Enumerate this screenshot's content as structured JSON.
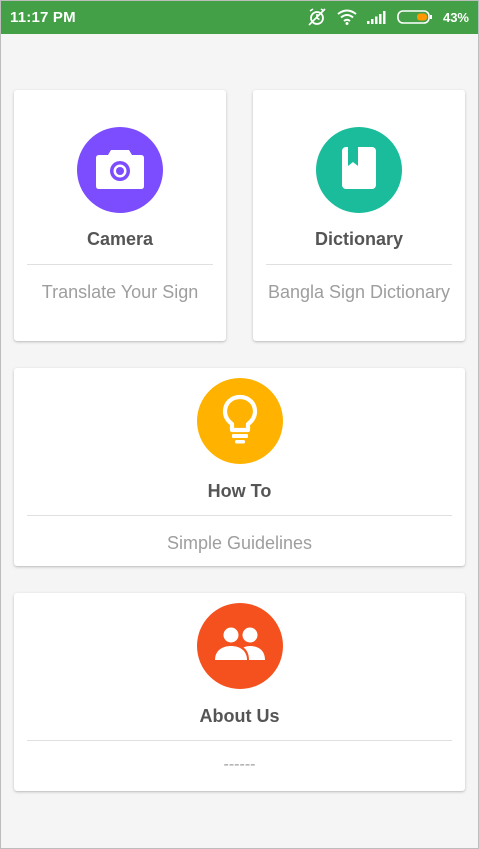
{
  "status_bar": {
    "time": "11:17 PM",
    "battery_percent": "43%",
    "icons": [
      "silent-alarm-icon",
      "wifi-icon",
      "signal-icon",
      "battery-icon"
    ]
  },
  "cards": {
    "camera": {
      "title": "Camera",
      "subtitle": "Translate Your Sign",
      "icon": "camera-icon",
      "color": "#7c4dff"
    },
    "dictionary": {
      "title": "Dictionary",
      "subtitle": "Bangla Sign Dictionary",
      "icon": "book-icon",
      "color": "#1abc9c"
    },
    "howto": {
      "title": "How To",
      "subtitle": "Simple Guidelines",
      "icon": "lightbulb-icon",
      "color": "#ffb300"
    },
    "about": {
      "title": "About Us",
      "subtitle": "------",
      "icon": "group-icon",
      "color": "#f4511e"
    }
  },
  "colors": {
    "status_bar": "#43a047",
    "background": "#f5f5f5",
    "battery_fill": "#ff9800"
  }
}
